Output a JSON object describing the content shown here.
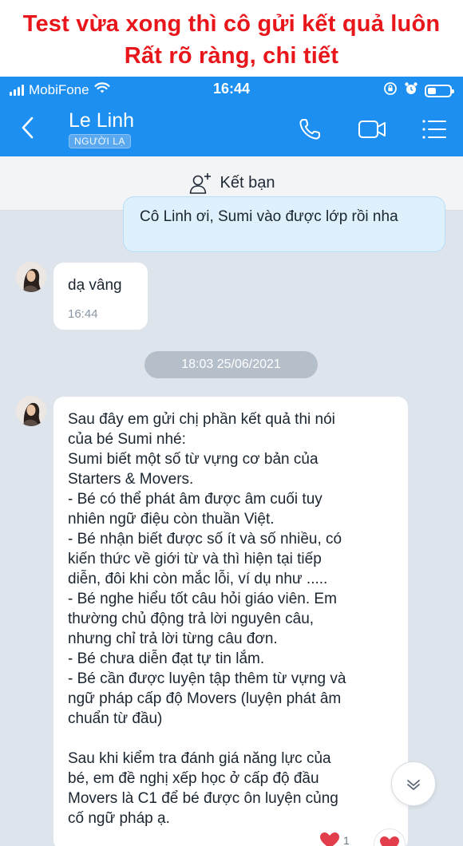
{
  "banner": {
    "line1": "Test vừa xong thì cô gửi kết quả luôn",
    "line2": "Rất rõ ràng, chi tiết"
  },
  "status_bar": {
    "carrier": "MobiFone",
    "time": "16:44",
    "icons": [
      "signal-icon",
      "wifi-icon",
      "lock-rotation-icon",
      "alarm-icon",
      "battery-icon"
    ]
  },
  "header": {
    "contact_name": "Le Linh",
    "tag": "NGƯỜI LẠ",
    "icons": [
      "back-icon",
      "phone-icon",
      "video-icon",
      "menu-icon"
    ],
    "accent_color": "#1d8ff1"
  },
  "add_friend": {
    "label": "Kết bạn"
  },
  "messages": {
    "outgoing_1": "Cô Linh ơi, Sumi vào được lớp rồi nha",
    "incoming_1": {
      "text": "dạ vâng",
      "time": "16:44"
    },
    "date_separator": "18:03 25/06/2021",
    "incoming_2": {
      "text": "Sau đây em gửi chị phần kết quả thi nói\ncủa bé Sumi nhé:\nSumi biết một số từ vựng cơ bản của\nStarters & Movers.\n- Bé có thể phát âm được âm cuối tuy\nnhiên ngữ điệu còn thuần Việt.\n- Bé nhận biết được số ít và số nhiều, có\nkiến thức về giới từ và thì hiện tại tiếp\ndiễn, đôi khi còn mắc lỗi, ví dụ như .....\n- Bé nghe hiểu tốt câu hỏi giáo viên. Em\nthường chủ động trả lời nguyên câu,\nnhưng chỉ trả lời từng câu đơn.\n- Bé chưa diễn đạt tự tin lắm.\n- Bé cần được luyện tập thêm từ vựng và\nngữ pháp cấp độ Movers (luyện phát âm\nchuẩn từ đầu)\n\nSau khi kiểm tra đánh giá năng lực của\nbé, em đề nghị xếp học ở cấp độ đầu\nMovers là C1 để bé được ôn luyện củng\ncố ngữ pháp ạ.",
      "reaction_count": "1"
    }
  },
  "colors": {
    "banner_text": "#e8161b",
    "chat_background": "#dde4ec",
    "outgoing_bubble": "#dff0fd",
    "reaction_heart": "#e23d4b"
  }
}
